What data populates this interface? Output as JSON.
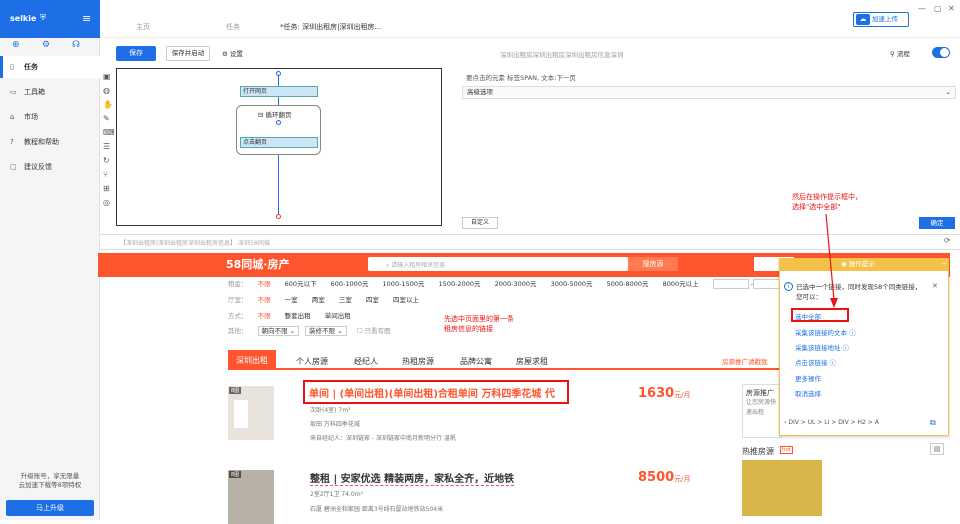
{
  "app": {
    "logo": "selkie"
  },
  "sidebar": {
    "items": [
      {
        "label": "任务",
        "icon": "file-icon"
      },
      {
        "label": "工具箱",
        "icon": "toolbox-icon"
      },
      {
        "label": "市场",
        "icon": "store-icon"
      },
      {
        "label": "教程和帮助",
        "icon": "help-icon"
      },
      {
        "label": "建议反馈",
        "icon": "feedback-icon"
      }
    ],
    "upgrade_text_1": "升级账号，享无限量",
    "upgrade_text_2": "云加速下载等8项特权",
    "upgrade_button": "马上升级"
  },
  "tabs": [
    "主页",
    "任务",
    "*任务: 深圳出租房|深圳出租房..."
  ],
  "cloud_button": "加速上传",
  "toolbar": {
    "save": "保存",
    "save_run": "保存并启动",
    "settings": "设置",
    "task_title": "深圳出租房深圳出租房深圳出租房信息深圳",
    "flow_label": "流程"
  },
  "designer": {
    "node_open": "打开网页",
    "loop": "循环翻页",
    "node_click": "点击翻页"
  },
  "props": {
    "header": "要点击的元素  标签SPAN, 文本:下一页",
    "advanced": "高级选项",
    "custom": "自定义",
    "confirm": "确定"
  },
  "url": "【深圳出租房|深圳出租房深圳出租房信息】-深圳58同城",
  "site": {
    "logo": "58同城·房产",
    "search_placeholder": "请输入租房相关信息",
    "search_button": "搜房源",
    "rent_label": "租金：",
    "rent_options": [
      "不限",
      "600元以下",
      "600-1000元",
      "1000-1500元",
      "1500-2000元",
      "2000-3000元",
      "3000-5000元",
      "5000-8000元",
      "8000元以上"
    ],
    "rent_unit": "元",
    "room_label": "厅室：",
    "room_options": [
      "不限",
      "一室",
      "两室",
      "三室",
      "四室",
      "四室以上"
    ],
    "mode_label": "方式：",
    "mode_options": [
      "不限",
      "整套出租",
      "单间出租"
    ],
    "other_label": "其他：",
    "other_selects": [
      "朝向不限",
      "装修不限"
    ],
    "video_check": "只看有图",
    "cat_tabs": [
      "深圳出租",
      "个人房源",
      "经纪人",
      "热租房源",
      "品牌公寓",
      "房屋求租"
    ],
    "cat_right": "房源推广请戳我",
    "listings": [
      {
        "tag": "8图",
        "title": "单间 | (单间出租)(单间出租)合租单间 万科四季花城 代",
        "meta1": "次卧(4室)   7m²",
        "meta2": "坂田    万科四季花城",
        "meta3": "来自经纪人：深圳链家 - 深圳链家中南月新明分行      温帆",
        "price": "1630",
        "unit": "元/月"
      },
      {
        "tag": "8图",
        "title": "整租 | 安家优选 精装两房，家私全齐，近地铁",
        "meta1": "2室2厅1卫   74.0m²",
        "meta2": "石厦    碧洲全和家园      距离3号线石厦站地铁站504米",
        "price": "8500",
        "unit": "元/月"
      }
    ],
    "ad_title": "房源推广",
    "ad_sub": "让您房源快速出租",
    "hot_label": "热推房源",
    "hot_badge": "hot"
  },
  "annotations": {
    "tip_1": "先选中页面里的第一条",
    "tip_2": "租房信息的链接",
    "top_1": "然后在操作提示框中，",
    "top_2": "选择\"选中全部\""
  },
  "optip": {
    "title": "操作提示",
    "message": "已选中一个链接，同时发现58个同类链接，您可以：",
    "links": [
      "选中全部",
      "采集该链接的文本",
      "采集该链接地址",
      "点击该链接",
      "更多操作",
      "取消选择"
    ],
    "path": "DIV  >  UL  >  LI  >  DIV  >  H2  >  A"
  },
  "colors": {
    "accent": "#1e6ee6",
    "brand": "#ff552e",
    "warning": "#f3c24b",
    "highlight": "#e11111"
  }
}
